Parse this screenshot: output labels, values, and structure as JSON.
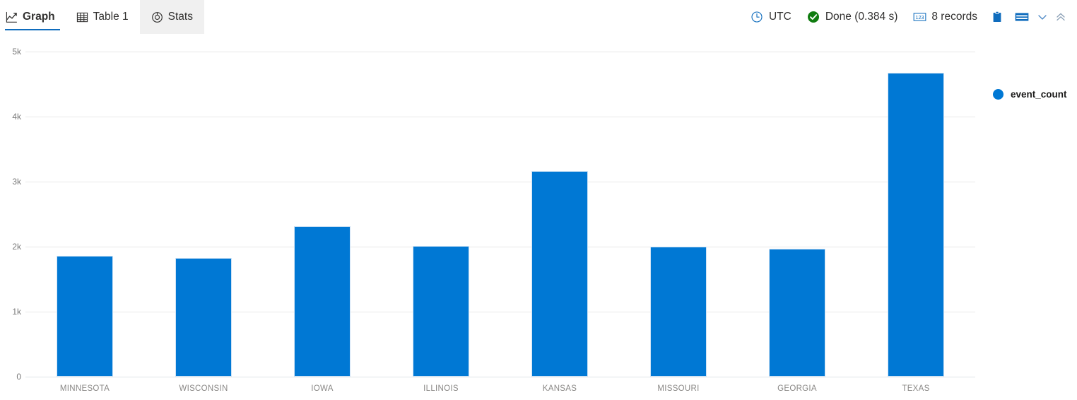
{
  "toolbar": {
    "tabs": [
      {
        "label": "Graph",
        "icon": "line-chart-icon",
        "active": true
      },
      {
        "label": "Table 1",
        "icon": "table-grid-icon",
        "active": false
      },
      {
        "label": "Stats",
        "icon": "donut-chart-icon",
        "active": false
      }
    ],
    "timezone": {
      "label": "UTC",
      "icon": "clock-icon"
    },
    "status": {
      "label": "Done (0.384 s)",
      "icon": "success-check-icon",
      "color": "#107c10"
    },
    "records": {
      "label": "8 records",
      "icon": "numeric-123-icon"
    },
    "actions": [
      {
        "name": "copy-to-clipboard-button",
        "icon": "clipboard-icon"
      },
      {
        "name": "table-layout-button",
        "icon": "table-rows-icon"
      },
      {
        "name": "layout-dropdown-button",
        "icon": "chevron-down-icon"
      },
      {
        "name": "collapse-panel-button",
        "icon": "double-chevron-up-icon"
      }
    ]
  },
  "chart_data": {
    "type": "bar",
    "title": "",
    "xlabel": "",
    "ylabel": "",
    "categories": [
      "MINNESOTA",
      "WISCONSIN",
      "IOWA",
      "ILLINOIS",
      "KANSAS",
      "MISSOURI",
      "GEORGIA",
      "TEXAS"
    ],
    "series": [
      {
        "name": "event_count",
        "color": "#0078d4",
        "values": [
          1860,
          1830,
          2315,
          2010,
          3165,
          2000,
          1970,
          4675
        ]
      }
    ],
    "ylim": [
      0,
      5000
    ],
    "yticks": [
      0,
      1000,
      2000,
      3000,
      4000,
      5000
    ],
    "ytick_labels": [
      "0",
      "1k",
      "2k",
      "3k",
      "4k",
      "5k"
    ],
    "grid": true,
    "legend": {
      "position": "right",
      "entries": [
        "event_count"
      ]
    }
  }
}
